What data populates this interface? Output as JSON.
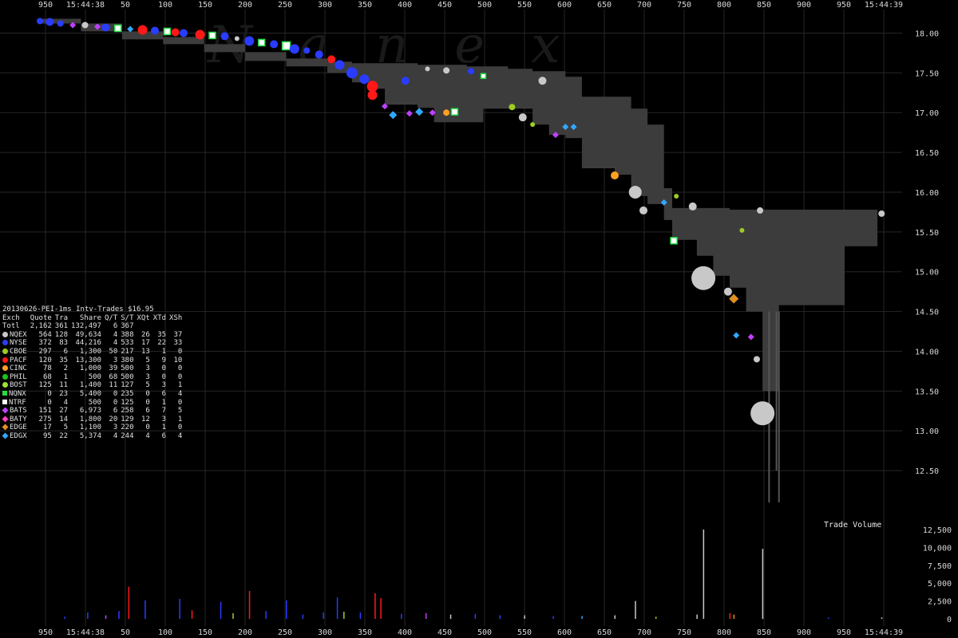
{
  "chart_data": {
    "type": "scatter",
    "watermark": "Nanex",
    "time_labels": {
      "start": "15:44:38",
      "end": "15:44:39"
    },
    "x_ticks": [
      "950",
      "15:44:38",
      "50",
      "100",
      "150",
      "200",
      "250",
      "300",
      "350",
      "400",
      "450",
      "500",
      "550",
      "600",
      "650",
      "700",
      "750",
      "800",
      "850",
      "900",
      "950",
      "15:44:39"
    ],
    "price_axis": {
      "ticks": [
        "18.00",
        "17.50",
        "17.00",
        "16.50",
        "16.00",
        "15.50",
        "15.00",
        "14.50",
        "14.00",
        "13.50",
        "13.00",
        "12.50"
      ],
      "range": [
        12.0,
        18.25
      ]
    },
    "volume_axis": {
      "label": "Trade Volume",
      "ticks": [
        "12,500",
        "10,000",
        "7,500",
        "5,000",
        "2,500",
        "0"
      ],
      "range": [
        0,
        12500
      ]
    },
    "quote_range": [
      [
        0,
        18.18,
        18.12
      ],
      [
        50,
        18.12,
        18.02
      ],
      [
        100,
        18.02,
        17.92
      ],
      [
        150,
        17.95,
        17.86
      ],
      [
        200,
        17.86,
        17.76
      ],
      [
        250,
        17.76,
        17.65
      ],
      [
        300,
        17.68,
        17.58
      ],
      [
        350,
        17.64,
        17.5
      ],
      [
        380,
        17.62,
        17.38
      ],
      [
        400,
        17.62,
        17.3
      ],
      [
        420,
        17.62,
        17.1
      ],
      [
        440,
        17.62,
        17.1
      ],
      [
        460,
        17.6,
        17.06
      ],
      [
        480,
        17.6,
        16.88
      ],
      [
        500,
        17.6,
        16.88
      ],
      [
        520,
        17.58,
        16.88
      ],
      [
        540,
        17.58,
        17.05
      ],
      [
        570,
        17.55,
        17.05
      ],
      [
        600,
        17.52,
        16.85
      ],
      [
        620,
        17.52,
        16.72
      ],
      [
        640,
        17.45,
        16.68
      ],
      [
        660,
        17.2,
        16.3
      ],
      [
        700,
        17.2,
        16.22
      ],
      [
        720,
        17.05,
        15.95
      ],
      [
        740,
        16.85,
        15.85
      ],
      [
        760,
        16.05,
        15.65
      ],
      [
        770,
        15.8,
        15.4
      ],
      [
        800,
        15.8,
        15.2
      ],
      [
        820,
        15.8,
        14.95
      ],
      [
        840,
        15.78,
        14.8
      ],
      [
        860,
        15.78,
        14.5
      ],
      [
        880,
        15.78,
        13.5
      ],
      [
        900,
        15.78,
        14.58
      ],
      [
        940,
        15.78,
        14.58
      ],
      [
        980,
        15.78,
        15.32
      ],
      [
        1020,
        15.78,
        15.32
      ]
    ],
    "quote_spikes": [
      {
        "x": 888,
        "low": 12.1
      },
      {
        "x": 897,
        "low": 12.5
      },
      {
        "x": 900,
        "low": 12.1
      }
    ],
    "trades": [
      {
        "x": 0,
        "y": 18.15,
        "exch": "NYSE",
        "size": 4
      },
      {
        "x": 12,
        "y": 18.14,
        "exch": "NYSE",
        "size": 5
      },
      {
        "x": 25,
        "y": 18.12,
        "exch": "NYSE",
        "size": 4
      },
      {
        "x": 40,
        "y": 18.1,
        "exch": "BATS",
        "size": 3
      },
      {
        "x": 55,
        "y": 18.1,
        "exch": "NQEX",
        "size": 4
      },
      {
        "x": 70,
        "y": 18.08,
        "exch": "BATS",
        "size": 3
      },
      {
        "x": 80,
        "y": 18.07,
        "exch": "NYSE",
        "size": 5
      },
      {
        "x": 95,
        "y": 18.06,
        "exch": "NQNX",
        "size": 4
      },
      {
        "x": 110,
        "y": 18.05,
        "exch": "EDGX",
        "size": 3
      },
      {
        "x": 125,
        "y": 18.04,
        "exch": "PACF",
        "size": 6
      },
      {
        "x": 140,
        "y": 18.03,
        "exch": "NYSE",
        "size": 5
      },
      {
        "x": 155,
        "y": 18.02,
        "exch": "NQNX",
        "size": 4
      },
      {
        "x": 165,
        "y": 18.01,
        "exch": "PACF",
        "size": 5
      },
      {
        "x": 175,
        "y": 18.0,
        "exch": "NYSE",
        "size": 5
      },
      {
        "x": 195,
        "y": 17.98,
        "exch": "PACF",
        "size": 6
      },
      {
        "x": 210,
        "y": 17.97,
        "exch": "NQNX",
        "size": 4
      },
      {
        "x": 225,
        "y": 17.96,
        "exch": "NYSE",
        "size": 5
      },
      {
        "x": 240,
        "y": 17.93,
        "exch": "NQEX",
        "size": 3
      },
      {
        "x": 255,
        "y": 17.9,
        "exch": "NYSE",
        "size": 6
      },
      {
        "x": 270,
        "y": 17.88,
        "exch": "NQNX",
        "size": 4
      },
      {
        "x": 285,
        "y": 17.86,
        "exch": "NYSE",
        "size": 5
      },
      {
        "x": 300,
        "y": 17.84,
        "exch": "NQNX",
        "size": 5
      },
      {
        "x": 310,
        "y": 17.8,
        "exch": "NYSE",
        "size": 6
      },
      {
        "x": 325,
        "y": 17.78,
        "exch": "NYSE",
        "size": 4
      },
      {
        "x": 340,
        "y": 17.73,
        "exch": "NYSE",
        "size": 5
      },
      {
        "x": 355,
        "y": 17.67,
        "exch": "PACF",
        "size": 5
      },
      {
        "x": 365,
        "y": 17.6,
        "exch": "NYSE",
        "size": 6
      },
      {
        "x": 380,
        "y": 17.5,
        "exch": "NYSE",
        "size": 7
      },
      {
        "x": 395,
        "y": 17.42,
        "exch": "NYSE",
        "size": 6
      },
      {
        "x": 405,
        "y": 17.33,
        "exch": "PACF",
        "size": 7
      },
      {
        "x": 405,
        "y": 17.22,
        "exch": "PACF",
        "size": 6
      },
      {
        "x": 420,
        "y": 17.08,
        "exch": "BATS",
        "size": 3
      },
      {
        "x": 430,
        "y": 16.97,
        "exch": "EDGX",
        "size": 4
      },
      {
        "x": 445,
        "y": 17.4,
        "exch": "NYSE",
        "size": 5
      },
      {
        "x": 450,
        "y": 16.99,
        "exch": "BATS",
        "size": 3
      },
      {
        "x": 462,
        "y": 17.01,
        "exch": "EDGX",
        "size": 4
      },
      {
        "x": 478,
        "y": 17.0,
        "exch": "BATS",
        "size": 3
      },
      {
        "x": 495,
        "y": 17.0,
        "exch": "CINC",
        "size": 4
      },
      {
        "x": 505,
        "y": 17.01,
        "exch": "NQNX",
        "size": 4
      },
      {
        "x": 472,
        "y": 17.55,
        "exch": "NQEX",
        "size": 3
      },
      {
        "x": 495,
        "y": 17.53,
        "exch": "NQEX",
        "size": 4
      },
      {
        "x": 525,
        "y": 17.52,
        "exch": "NYSE",
        "size": 4
      },
      {
        "x": 540,
        "y": 17.46,
        "exch": "NQNX",
        "size": 3
      },
      {
        "x": 575,
        "y": 17.07,
        "exch": "CBOE",
        "size": 4
      },
      {
        "x": 588,
        "y": 16.94,
        "exch": "NQEX",
        "size": 5
      },
      {
        "x": 600,
        "y": 16.85,
        "exch": "CBOE",
        "size": 3
      },
      {
        "x": 612,
        "y": 17.4,
        "exch": "NQEX",
        "size": 5
      },
      {
        "x": 628,
        "y": 16.72,
        "exch": "BATS",
        "size": 3
      },
      {
        "x": 640,
        "y": 16.82,
        "exch": "EDGX",
        "size": 3
      },
      {
        "x": 650,
        "y": 16.82,
        "exch": "EDGX",
        "size": 3
      },
      {
        "x": 700,
        "y": 16.21,
        "exch": "CINC",
        "size": 5
      },
      {
        "x": 725,
        "y": 16.0,
        "exch": "NQEX",
        "size": 8
      },
      {
        "x": 735,
        "y": 15.77,
        "exch": "NQEX",
        "size": 5
      },
      {
        "x": 760,
        "y": 15.87,
        "exch": "EDGX",
        "size": 3
      },
      {
        "x": 775,
        "y": 15.95,
        "exch": "CBOE",
        "size": 3
      },
      {
        "x": 795,
        "y": 15.82,
        "exch": "NQEX",
        "size": 5
      },
      {
        "x": 772,
        "y": 15.39,
        "exch": "NQNX",
        "size": 4
      },
      {
        "x": 808,
        "y": 14.92,
        "exch": "NQEX",
        "size": 15
      },
      {
        "x": 838,
        "y": 14.75,
        "exch": "NQEX",
        "size": 5
      },
      {
        "x": 845,
        "y": 14.66,
        "exch": "EDGE",
        "size": 5
      },
      {
        "x": 848,
        "y": 14.2,
        "exch": "EDGX",
        "size": 3
      },
      {
        "x": 855,
        "y": 15.52,
        "exch": "CBOE",
        "size": 3
      },
      {
        "x": 866,
        "y": 14.18,
        "exch": "BATS",
        "size": 3
      },
      {
        "x": 873,
        "y": 13.9,
        "exch": "NQEX",
        "size": 4
      },
      {
        "x": 880,
        "y": 13.22,
        "exch": "NQEX",
        "size": 15
      },
      {
        "x": 877,
        "y": 15.77,
        "exch": "NQEX",
        "size": 4
      },
      {
        "x": 1025,
        "y": 15.73,
        "exch": "NQEX",
        "size": 4
      }
    ],
    "volume_bars": [
      {
        "x": 30,
        "v": 300,
        "exch": "NYSE"
      },
      {
        "x": 58,
        "v": 900,
        "exch": "NYSE"
      },
      {
        "x": 80,
        "v": 500,
        "exch": "BATS"
      },
      {
        "x": 96,
        "v": 1100,
        "exch": "NYSE"
      },
      {
        "x": 108,
        "v": 4500,
        "exch": "PACF"
      },
      {
        "x": 128,
        "v": 2600,
        "exch": "NYSE"
      },
      {
        "x": 170,
        "v": 2800,
        "exch": "NYSE"
      },
      {
        "x": 185,
        "v": 1200,
        "exch": "PACF"
      },
      {
        "x": 220,
        "v": 2400,
        "exch": "NYSE"
      },
      {
        "x": 235,
        "v": 800,
        "exch": "CBOE"
      },
      {
        "x": 255,
        "v": 3900,
        "exch": "PACF"
      },
      {
        "x": 275,
        "v": 1100,
        "exch": "NYSE"
      },
      {
        "x": 300,
        "v": 2600,
        "exch": "NYSE"
      },
      {
        "x": 320,
        "v": 600,
        "exch": "NYSE"
      },
      {
        "x": 345,
        "v": 900,
        "exch": "NYSE"
      },
      {
        "x": 362,
        "v": 3000,
        "exch": "NYSE"
      },
      {
        "x": 370,
        "v": 1000,
        "exch": "CBOE"
      },
      {
        "x": 390,
        "v": 900,
        "exch": "NYSE"
      },
      {
        "x": 408,
        "v": 3600,
        "exch": "PACF"
      },
      {
        "x": 415,
        "v": 2900,
        "exch": "PACF"
      },
      {
        "x": 440,
        "v": 700,
        "exch": "NYSE"
      },
      {
        "x": 470,
        "v": 800,
        "exch": "BATS"
      },
      {
        "x": 500,
        "v": 600,
        "exch": "NQEX"
      },
      {
        "x": 530,
        "v": 700,
        "exch": "NYSE"
      },
      {
        "x": 560,
        "v": 500,
        "exch": "NYSE"
      },
      {
        "x": 590,
        "v": 500,
        "exch": "NQEX"
      },
      {
        "x": 625,
        "v": 400,
        "exch": "NYSE"
      },
      {
        "x": 660,
        "v": 400,
        "exch": "EDGX"
      },
      {
        "x": 700,
        "v": 500,
        "exch": "NQEX"
      },
      {
        "x": 725,
        "v": 2500,
        "exch": "NQEX"
      },
      {
        "x": 750,
        "v": 300,
        "exch": "CBOE"
      },
      {
        "x": 800,
        "v": 600,
        "exch": "NQEX"
      },
      {
        "x": 808,
        "v": 12500,
        "exch": "NQEX"
      },
      {
        "x": 840,
        "v": 800,
        "exch": "PACF"
      },
      {
        "x": 845,
        "v": 600,
        "exch": "EDGE"
      },
      {
        "x": 880,
        "v": 9800,
        "exch": "NQEX"
      },
      {
        "x": 960,
        "v": 200,
        "exch": "NYSE"
      },
      {
        "x": 1025,
        "v": 200,
        "exch": "NQEX"
      }
    ]
  },
  "stats": {
    "title": "20130626-PEI-1ms Intv-Trades $16.95",
    "columns": [
      "Exch",
      "Quote",
      "Tra",
      "Share",
      "Q/T",
      "S/T",
      "XQt",
      "XTd",
      "XSh"
    ],
    "total": [
      "Totl",
      "2,162",
      "361",
      "132,497",
      "6",
      "367",
      "",
      "",
      ""
    ],
    "rows": [
      {
        "name": "NQEX",
        "quote": "564",
        "tra": "128",
        "share": "49,634",
        "qt": "4",
        "st": "388",
        "xqt": "26",
        "xtd": "35",
        "xsh": "37",
        "color": "#c8c8c8",
        "shape": "circle"
      },
      {
        "name": "NYSE",
        "quote": "372",
        "tra": "83",
        "share": "44,216",
        "qt": "4",
        "st": "533",
        "xqt": "17",
        "xtd": "22",
        "xsh": "33",
        "color": "#2a3cff",
        "shape": "circle"
      },
      {
        "name": "CBOE",
        "quote": "297",
        "tra": "6",
        "share": "1,300",
        "qt": "50",
        "st": "217",
        "xqt": "13",
        "xtd": "1",
        "xsh": "0",
        "color": "#9ccc22",
        "shape": "circle"
      },
      {
        "name": "PACF",
        "quote": "120",
        "tra": "35",
        "share": "13,300",
        "qt": "3",
        "st": "380",
        "xqt": "5",
        "xtd": "9",
        "xsh": "10",
        "color": "#ff1818",
        "shape": "circle"
      },
      {
        "name": "CINC",
        "quote": "78",
        "tra": "2",
        "share": "1,000",
        "qt": "39",
        "st": "500",
        "xqt": "3",
        "xtd": "0",
        "xsh": "0",
        "color": "#ffa020",
        "shape": "circle"
      },
      {
        "name": "PHIL",
        "quote": "68",
        "tra": "1",
        "share": "500",
        "qt": "68",
        "st": "500",
        "xqt": "3",
        "xtd": "0",
        "xsh": "0",
        "color": "#18c818",
        "shape": "circle"
      },
      {
        "name": "BOST",
        "quote": "125",
        "tra": "11",
        "share": "1,400",
        "qt": "11",
        "st": "127",
        "xqt": "5",
        "xtd": "3",
        "xsh": "1",
        "color": "#a0e030",
        "shape": "circle"
      },
      {
        "name": "NQNX",
        "quote": "0",
        "tra": "23",
        "share": "5,400",
        "qt": "0",
        "st": "235",
        "xqt": "0",
        "xtd": "6",
        "xsh": "4",
        "color": "#22dd44",
        "shape": "square"
      },
      {
        "name": "NTRF",
        "quote": "0",
        "tra": "4",
        "share": "500",
        "qt": "0",
        "st": "125",
        "xqt": "0",
        "xtd": "1",
        "xsh": "0",
        "color": "#ffffff",
        "shape": "square"
      },
      {
        "name": "BATS",
        "quote": "151",
        "tra": "27",
        "share": "6,973",
        "qt": "6",
        "st": "258",
        "xqt": "6",
        "xtd": "7",
        "xsh": "5",
        "color": "#c040ff",
        "shape": "diamond"
      },
      {
        "name": "BATY",
        "quote": "275",
        "tra": "14",
        "share": "1,800",
        "qt": "20",
        "st": "129",
        "xqt": "12",
        "xtd": "3",
        "xsh": "1",
        "color": "#ff40c0",
        "shape": "diamond"
      },
      {
        "name": "EDGE",
        "quote": "17",
        "tra": "5",
        "share": "1,100",
        "qt": "3",
        "st": "220",
        "xqt": "0",
        "xtd": "1",
        "xsh": "0",
        "color": "#e09020",
        "shape": "diamond"
      },
      {
        "name": "EDGX",
        "quote": "95",
        "tra": "22",
        "share": "5,374",
        "qt": "4",
        "st": "244",
        "xqt": "4",
        "xtd": "6",
        "xsh": "4",
        "color": "#30a8ff",
        "shape": "diamond"
      }
    ]
  },
  "colors": {
    "background": "#000000",
    "quote_band": "#3c3c3c",
    "grid": "#262626",
    "tick_text": "#d8d8d8"
  }
}
